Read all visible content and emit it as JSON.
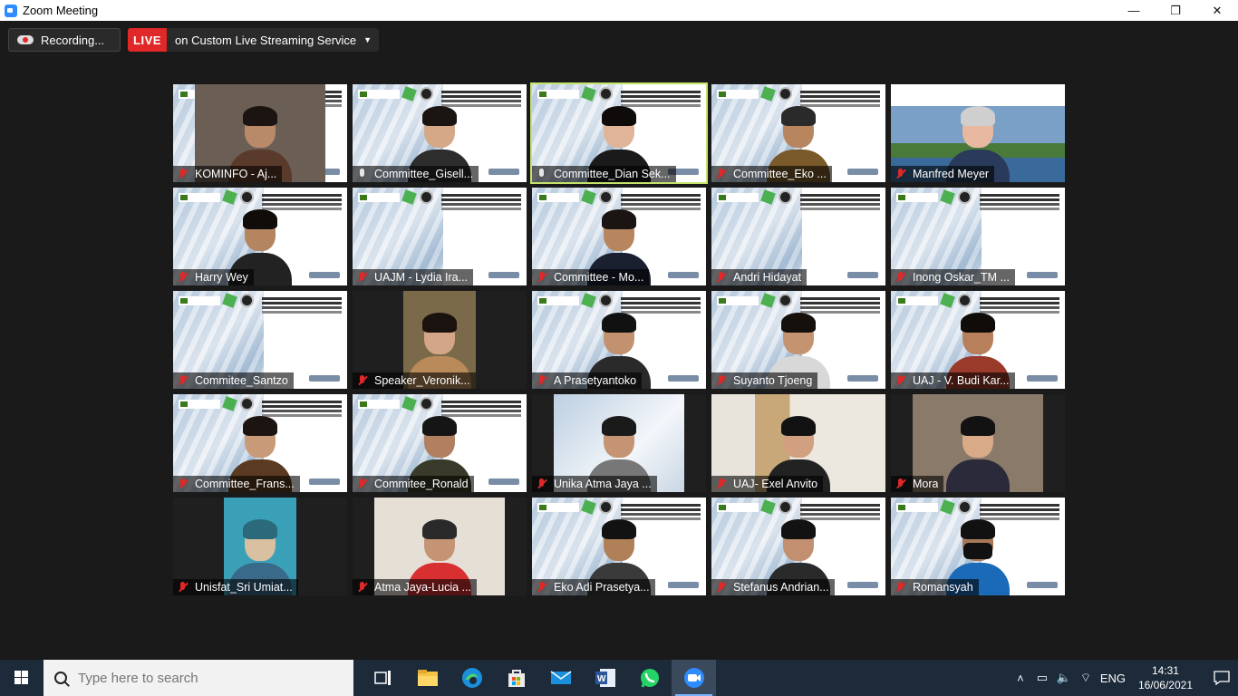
{
  "window": {
    "title": "Zoom Meeting",
    "minimize": "—",
    "maximize": "❐",
    "close": "✕"
  },
  "toolbar": {
    "recording_label": "Recording...",
    "live_badge": "LIVE",
    "live_service": "on Custom Live Streaming Service",
    "live_caret": "▼"
  },
  "participants": [
    {
      "name": "KOMINFO - Aj...",
      "muted": true
    },
    {
      "name": "Committee_Gisell...",
      "muted": false
    },
    {
      "name": "Committee_Dian Sek...",
      "muted": false,
      "active_speaker": true
    },
    {
      "name": "Committee_Eko ...",
      "muted": true
    },
    {
      "name": "Manfred Meyer",
      "muted": true
    },
    {
      "name": "Harry Wey",
      "muted": true
    },
    {
      "name": "UAJM - Lydia Ira...",
      "muted": true
    },
    {
      "name": "Committee - Mo...",
      "muted": true
    },
    {
      "name": "Andri Hidayat",
      "muted": true
    },
    {
      "name": "Inong Oskar_TM ...",
      "muted": true
    },
    {
      "name": "Commitee_Santzo",
      "muted": true
    },
    {
      "name": "Speaker_Veronik...",
      "muted": true
    },
    {
      "name": "A Prasetyantoko",
      "muted": true
    },
    {
      "name": "Suyanto Tjoeng",
      "muted": true
    },
    {
      "name": "UAJ - V. Budi Kar...",
      "muted": true
    },
    {
      "name": "Committee_Frans...",
      "muted": true
    },
    {
      "name": "Commitee_Ronald",
      "muted": true
    },
    {
      "name": "Unika Atma Jaya ...",
      "muted": true
    },
    {
      "name": "UAJ- Exel Anvito",
      "muted": true
    },
    {
      "name": "Mora",
      "muted": true
    },
    {
      "name": "Unisfat_Sri Umiat...",
      "muted": true
    },
    {
      "name": "Atma Jaya-Lucia ...",
      "muted": true
    },
    {
      "name": "Eko Adi Prasetya...",
      "muted": true
    },
    {
      "name": "Stefanus Andrian...",
      "muted": true
    },
    {
      "name": "Romansyah",
      "muted": true
    }
  ],
  "taskbar": {
    "search_placeholder": "Type here to search",
    "apps": [
      "task-view-icon",
      "file-explorer-icon",
      "edge-icon",
      "store-icon",
      "mail-icon",
      "word-icon",
      "whatsapp-icon",
      "zoom-icon"
    ],
    "language": "ENG",
    "time": "14:31",
    "date": "16/06/2021"
  }
}
